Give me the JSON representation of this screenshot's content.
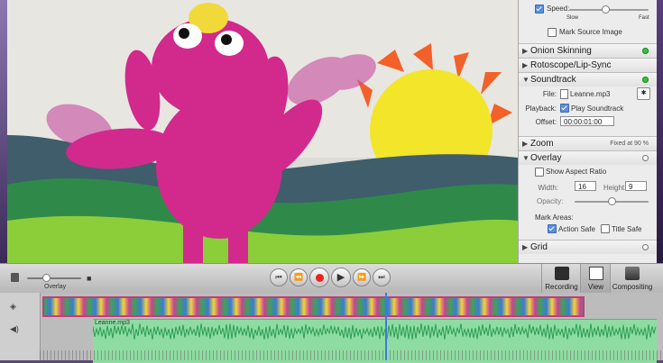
{
  "panel": {
    "speed": {
      "label": "Speed:",
      "slow": "Slow",
      "fast": "Fast",
      "value": 0.45,
      "checked": true
    },
    "mark_source": {
      "label": "Mark Source Image",
      "checked": false
    },
    "sections": {
      "onion": {
        "title": "Onion Skinning",
        "status": "on"
      },
      "roto": {
        "title": "Rotoscope/Lip-Sync"
      },
      "soundtrack": {
        "title": "Soundtrack",
        "status": "on"
      },
      "zoom": {
        "title": "Zoom",
        "info": "Fixed at 90 %"
      },
      "overlay": {
        "title": "Overlay",
        "status": "off"
      },
      "grid": {
        "title": "Grid",
        "status": "off"
      }
    },
    "soundtrack": {
      "file_label": "File:",
      "file_value": "Leanne.mp3",
      "playback_label": "Playback:",
      "play_label": "Play Soundtrack",
      "play_checked": true,
      "offset_label": "Offset:",
      "offset_value": "00:00:01:00"
    },
    "overlay": {
      "aspect_label": "Show Aspect Ratio",
      "aspect_checked": false,
      "width_label": "Width:",
      "width_value": "16",
      "height_label": "Height:",
      "height_value": "9",
      "opacity_label": "Opacity:",
      "opacity_value": 0.5,
      "mark_areas_label": "Mark Areas:",
      "action_safe_label": "Action Safe",
      "action_safe_checked": true,
      "title_safe_label": "Title Safe",
      "title_safe_checked": false
    }
  },
  "toolbar": {
    "overlay_label": "Overlay",
    "overlay_value": 0.35,
    "modes": {
      "recording": "Recording",
      "view": "View",
      "compositing": "Compositing"
    }
  },
  "timeline": {
    "audio_track_label": "Leanne.mp3"
  }
}
